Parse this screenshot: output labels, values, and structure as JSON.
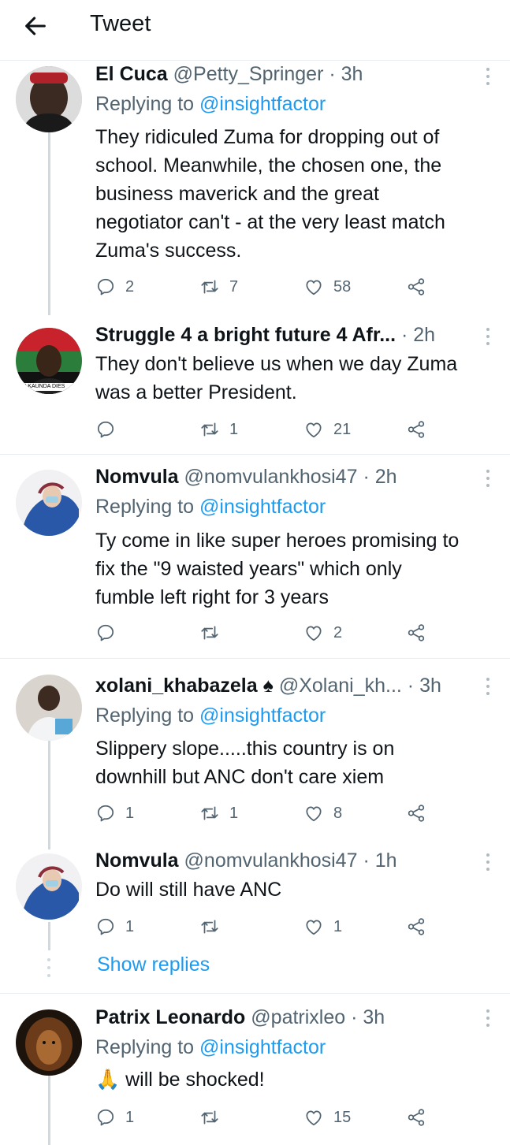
{
  "header": {
    "title": "Tweet"
  },
  "tweets": [
    {
      "name": "El Cuca",
      "handle_time": "@Petty_Springer · 3h",
      "replying_prefix": "Replying to ",
      "replying_handle": "@insightfactor",
      "lines": [
        "They ridiculed Zuma for dropping out of",
        "school. Meanwhile, the chosen one, the",
        "business maverick and the great",
        "negotiator can't - at the very least match",
        "Zuma's success."
      ],
      "replies": "2",
      "retweets": "7",
      "likes": "58"
    },
    {
      "name": "Struggle 4 a bright future 4 Afr...",
      "handle_time": " · 2h",
      "lines": [
        "They don't believe us when we day Zuma",
        "was a better President."
      ],
      "replies": "",
      "retweets": "1",
      "likes": "21",
      "avatar_caption": "TH KAUNDA DIES"
    },
    {
      "name": "Nomvula",
      "handle_time": "@nomvulankhosi47 · 2h",
      "replying_prefix": "Replying to ",
      "replying_handle": "@insightfactor",
      "lines": [
        "Ty come in like super heroes  promising to",
        "fix the \"9 waisted years\" which only",
        "fumble left right for 3 years"
      ],
      "replies": "",
      "retweets": "",
      "likes": "2"
    },
    {
      "name": "xolani_khabazela",
      "badge": "♠",
      "handle_time": "@Xolani_kh... · 3h",
      "replying_prefix": "Replying to ",
      "replying_handle": "@insightfactor",
      "lines": [
        "Slippery slope.....this country is on",
        "downhill but ANC don't care xiem"
      ],
      "replies": "1",
      "retweets": "1",
      "likes": "8"
    },
    {
      "name": "Nomvula",
      "handle_time": "@nomvulankhosi47 · 1h",
      "lines": [
        "Do will still have ANC"
      ],
      "replies": "1",
      "retweets": "",
      "likes": "1"
    },
    {
      "name": "Patrix Leonardo",
      "handle_time": "@patrixleo · 3h",
      "replying_prefix": "Replying to ",
      "replying_handle": "@insightfactor",
      "emoji": "🙏",
      "lines": [
        "will be shocked!"
      ],
      "replies": "1",
      "retweets": "",
      "likes": "15"
    }
  ],
  "show_replies": "Show replies",
  "colors": {
    "accent": "#1d9bf0",
    "muted": "#536471",
    "text": "#0f1419",
    "divider": "#e6ecf0"
  },
  "icons": [
    "back-arrow-icon",
    "more-icon",
    "reply-icon",
    "retweet-icon",
    "like-icon",
    "share-icon"
  ]
}
